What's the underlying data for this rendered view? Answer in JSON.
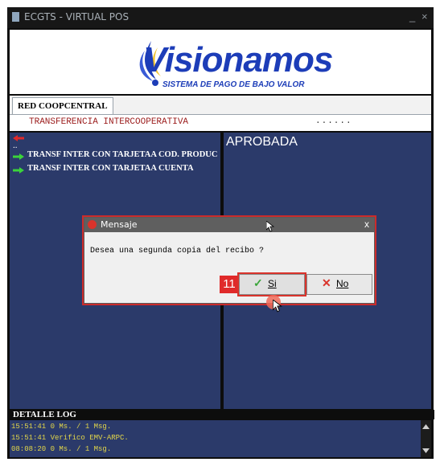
{
  "window": {
    "title": "ECGTS - VIRTUAL POS",
    "minimize_label": "_",
    "close_label": "×"
  },
  "banner": {
    "logo_text": "Visionamos",
    "tagline": "SISTEMA DE PAGO DE BAJO VALOR"
  },
  "tabs": [
    {
      "label": "RED COOPCENTRAL"
    }
  ],
  "transaction": {
    "title": "TRANSFERENCIA INTERCOOPERATIVA",
    "indicator": "......"
  },
  "menu": {
    "back_label": "..",
    "items": [
      {
        "label": "TRANSF INTER CON TARJETAA COD. PRODUC"
      },
      {
        "label": "TRANSF INTER CON TARJETAA CUENTA"
      }
    ]
  },
  "status_panel": {
    "status": "APROBADA"
  },
  "log": {
    "label": "DETALLE LOG",
    "lines": [
      "15:51:41 0 Ms. / 1 Msg.",
      "15:51:41 Verifico EMV-ARPC.",
      "08:08:20 0 Ms. / 1 Msg."
    ]
  },
  "dialog": {
    "title": "Mensaje",
    "close_label": "x",
    "message": "Desea una segunda copia del recibo ?",
    "yes_label": "Si",
    "no_label": "No",
    "step_badge": "11"
  },
  "colors": {
    "panel_bg": "#2b3a6a",
    "accent_red": "#e02a2a",
    "log_text": "#e2d64a",
    "title_text": "#9b1c1c",
    "logo_blue": "#1d3db8"
  }
}
